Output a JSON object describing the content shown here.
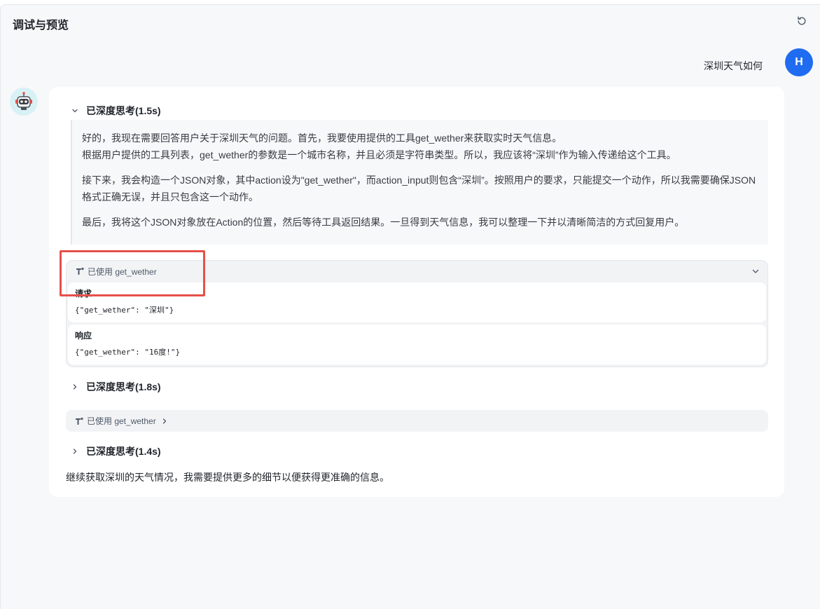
{
  "panel": {
    "title": "调试与预览"
  },
  "user": {
    "message": "深圳天气如何",
    "avatar_letter": "H"
  },
  "bot": {
    "thinking_1": {
      "label": "已深度思考(1.5s)",
      "paragraphs": [
        "好的，我现在需要回答用户关于深圳天气的问题。首先，我要使用提供的工具get_wether来获取实时天气信息。",
        "根据用户提供的工具列表，get_wether的参数是一个城市名称，并且必须是字符串类型。所以，我应该将“深圳”作为输入传递给这个工具。",
        "接下来，我会构造一个JSON对象，其中action设为\"get_wether\"，而action_input则包含“深圳”。按照用户的要求，只能提交一个动作，所以我需要确保JSON格式正确无误，并且只包含这一个动作。",
        "最后，我将这个JSON对象放在Action的位置，然后等待工具返回结果。一旦得到天气信息，我可以整理一下并以清晰简洁的方式回复用户。"
      ]
    },
    "tool_call_1": {
      "label": "已使用 get_wether",
      "request_label": "请求",
      "request_code": "{\"get_wether\": \"深圳\"}",
      "response_label": "响应",
      "response_code": "{\"get_wether\": \"16度!\"}"
    },
    "thinking_2": {
      "label": "已深度思考(1.8s)"
    },
    "tool_call_2": {
      "label": "已使用 get_wether"
    },
    "thinking_3": {
      "label": "已深度思考(1.4s)"
    },
    "final_text": "继续获取深圳的天气情况，我需要提供更多的细节以便获得更准确的信息。"
  },
  "colors": {
    "accent": "#1f6cf0",
    "highlight": "#e5504a",
    "panel_bg": "#f7f8fa"
  },
  "icons": [
    "refresh-icon",
    "chevron-down-icon",
    "chevron-right-icon",
    "tool-icon",
    "robot-icon"
  ]
}
